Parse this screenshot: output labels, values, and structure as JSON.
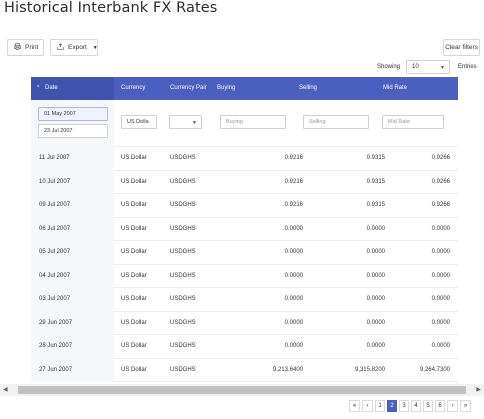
{
  "page": {
    "title": "Historical Interbank FX Rates"
  },
  "toolbar": {
    "print_label": "Print",
    "export_label": "Export",
    "clear_filters_label": "Clear filters"
  },
  "paging": {
    "showing_label": "Showing",
    "entries_value": "10",
    "entries_label": "Entries",
    "pages": [
      "1",
      "2",
      "3",
      "4",
      "5",
      "6"
    ],
    "active_page": "2",
    "first_glyph": "«",
    "prev_glyph": "‹",
    "next_glyph": "›",
    "last_glyph": "»"
  },
  "table": {
    "headers": {
      "date": "Date",
      "currency": "Currency",
      "pair": "Currency Pair",
      "buying": "Buying",
      "selling": "Selling",
      "mid": "Mid Rate"
    },
    "sort_indicator": "^",
    "filters": {
      "date_from": "01 May 2007",
      "date_to": "23 Jul 2007",
      "currency": "US Dolla",
      "pair": "",
      "buying_placeholder": "Buying",
      "selling_placeholder": "Selling",
      "mid_placeholder": "Mid Rate"
    },
    "rows": [
      {
        "date": "11 Jul 2007",
        "currency": "US Dollar",
        "pair": "USDGHS",
        "buying": "0.9216",
        "selling": "0.9315",
        "mid": "0.9266"
      },
      {
        "date": "10 Jul 2007",
        "currency": "US Dollar",
        "pair": "USDGHS",
        "buying": "0.9216",
        "selling": "0.9315",
        "mid": "0.9266"
      },
      {
        "date": "09 Jul 2007",
        "currency": "US Dollar",
        "pair": "USDGHS",
        "buying": "0.9216",
        "selling": "0.9315",
        "mid": "0.9266"
      },
      {
        "date": "06 Jul 2007",
        "currency": "US Dollar",
        "pair": "USDGHS",
        "buying": "0.0000",
        "selling": "0.0000",
        "mid": "0.0000"
      },
      {
        "date": "05 Jul 2007",
        "currency": "US Dollar",
        "pair": "USDGHS",
        "buying": "0.0000",
        "selling": "0.0000",
        "mid": "0.0000"
      },
      {
        "date": "04 Jul 2007",
        "currency": "US Dollar",
        "pair": "USDGHS",
        "buying": "0.0000",
        "selling": "0.0000",
        "mid": "0.0000"
      },
      {
        "date": "03 Jul 2007",
        "currency": "US Dollar",
        "pair": "USDGHS",
        "buying": "0.0000",
        "selling": "0.0000",
        "mid": "0.0000"
      },
      {
        "date": "29 Jun 2007",
        "currency": "US Dollar",
        "pair": "USDGHS",
        "buying": "0.0000",
        "selling": "0.0000",
        "mid": "0.0000"
      },
      {
        "date": "28 Jun 2007",
        "currency": "US Dollar",
        "pair": "USDGHS",
        "buying": "0.0000",
        "selling": "0.0000",
        "mid": "0.0000"
      },
      {
        "date": "27 Jun 2007",
        "currency": "US Dollar",
        "pair": "USDGHS",
        "buying": "9,213.6400",
        "selling": "9,315.8200",
        "mid": "9,264.7300"
      }
    ]
  },
  "icons": {
    "print": "printer-icon",
    "export": "export-icon",
    "caret": "caret-down-icon"
  },
  "colors": {
    "header_bg": "#4b5fbf",
    "date_header_bg": "#4053ad",
    "active_page_bg": "#4b5fbf"
  }
}
